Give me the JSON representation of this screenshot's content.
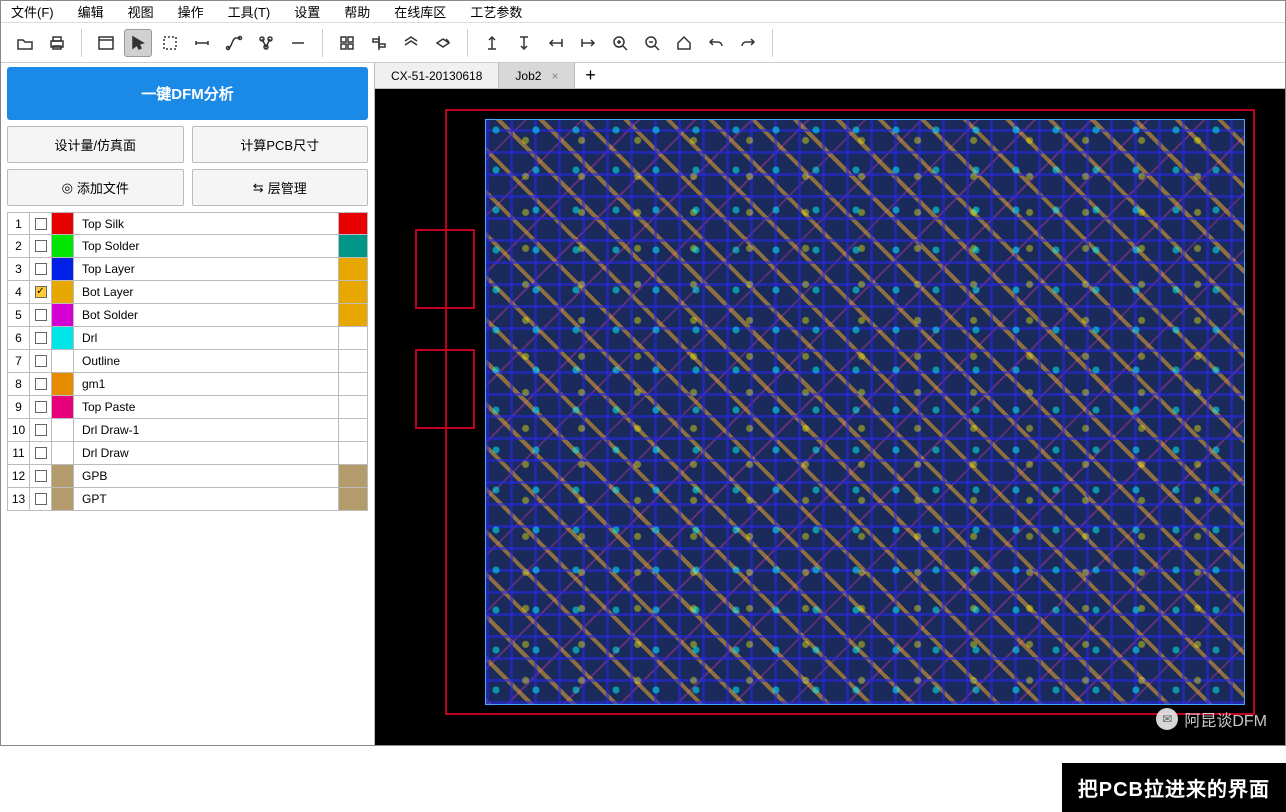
{
  "menu": [
    "文件(F)",
    "编辑",
    "视图",
    "操作",
    "工具(T)",
    "设置",
    "帮助",
    "在线库区",
    "工艺参数"
  ],
  "sidebar": {
    "dfm_btn": "一键DFM分析",
    "row1": [
      "设计量/仿真面",
      "计算PCB尺寸"
    ],
    "row2": [
      "添加文件",
      "层管理"
    ]
  },
  "layers": [
    {
      "idx": 1,
      "checked": false,
      "color": "#e60000",
      "name": "Top Silk",
      "tail": "#e60000"
    },
    {
      "idx": 2,
      "checked": false,
      "color": "#00e600",
      "name": "Top Solder",
      "tail": "#009688"
    },
    {
      "idx": 3,
      "checked": false,
      "color": "#0020e6",
      "name": "Top Layer",
      "tail": "#e6a800"
    },
    {
      "idx": 4,
      "checked": true,
      "color": "#e6a800",
      "name": "Bot Layer",
      "tail": "#e6a800"
    },
    {
      "idx": 5,
      "checked": false,
      "color": "#d400d4",
      "name": "Bot Solder",
      "tail": "#e6a800"
    },
    {
      "idx": 6,
      "checked": false,
      "color": "#00e6e6",
      "name": "Drl",
      "tail": "#ffffff"
    },
    {
      "idx": 7,
      "checked": false,
      "color": "#ffffff",
      "name": "Outline",
      "tail": "#ffffff"
    },
    {
      "idx": 8,
      "checked": false,
      "color": "#e68a00",
      "name": "gm1",
      "tail": "#ffffff"
    },
    {
      "idx": 9,
      "checked": false,
      "color": "#e6007a",
      "name": "Top Paste",
      "tail": "#ffffff"
    },
    {
      "idx": 10,
      "checked": false,
      "color": "#ffffff",
      "name": "Drl Draw-1",
      "tail": "#ffffff"
    },
    {
      "idx": 11,
      "checked": false,
      "color": "#ffffff",
      "name": "Drl Draw",
      "tail": "#ffffff"
    },
    {
      "idx": 12,
      "checked": false,
      "color": "#b39b6b",
      "name": "GPB",
      "tail": "#b39b6b"
    },
    {
      "idx": 13,
      "checked": false,
      "color": "#b39b6b",
      "name": "GPT",
      "tail": "#b39b6b"
    }
  ],
  "tabs": [
    {
      "label": "CX-51-20130618",
      "active": false,
      "closable": false
    },
    {
      "label": "Job2",
      "active": true,
      "closable": true
    }
  ],
  "watermark": "阿昆谈DFM",
  "caption": "把PCB拉进来的界面"
}
